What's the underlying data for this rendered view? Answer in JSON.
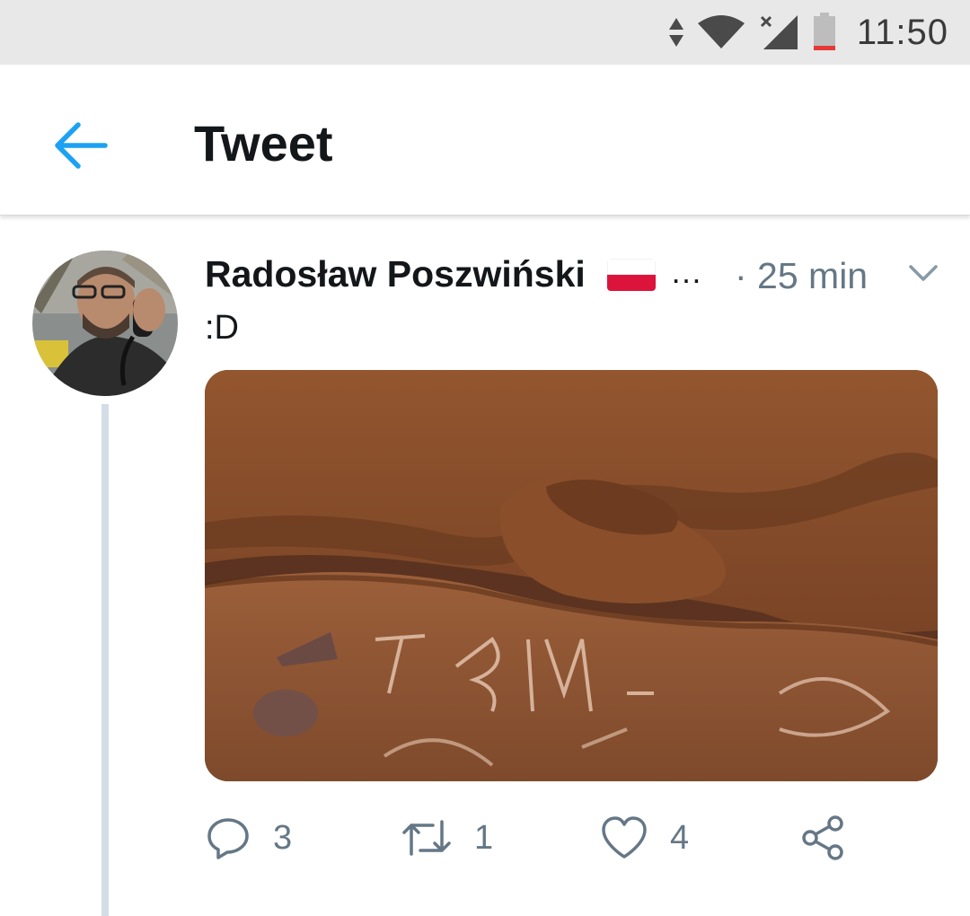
{
  "status_bar": {
    "time": "11:50",
    "icons": [
      "data-arrows-icon",
      "wifi-icon",
      "signal-no-service-icon",
      "battery-low-icon"
    ],
    "battery_color": "#e53935"
  },
  "header": {
    "title": "Tweet",
    "back_icon": "arrow-left-icon",
    "accent": "#1da1f2"
  },
  "tweet": {
    "author": "Radosław Poszwiński",
    "flag": "poland-flag-icon",
    "ellipsis": "…",
    "timestamp": "· 25 min",
    "text": ":D",
    "actions": {
      "reply_count": "3",
      "retweet_count": "1",
      "like_count": "4"
    }
  },
  "colors": {
    "text_primary": "#14171a",
    "text_secondary": "#657786",
    "thread_line": "#d3dde5",
    "status_bar_bg": "#e8e8e8"
  }
}
